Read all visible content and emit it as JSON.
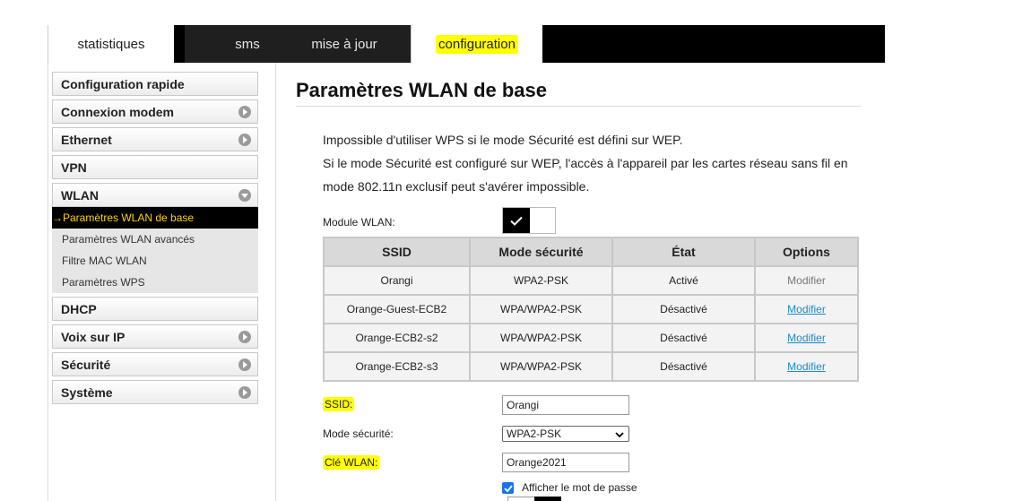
{
  "tabs": [
    {
      "label": "statistiques"
    },
    {
      "label": "sms"
    },
    {
      "label": "mise à jour"
    },
    {
      "label": "configuration"
    }
  ],
  "sidebar": {
    "items": [
      {
        "label": "Configuration rapide"
      },
      {
        "label": "Connexion modem"
      },
      {
        "label": "Ethernet"
      },
      {
        "label": "VPN"
      },
      {
        "label": "WLAN"
      },
      {
        "label": "DHCP"
      },
      {
        "label": "Voix sur IP"
      },
      {
        "label": "Sécurité"
      },
      {
        "label": "Système"
      }
    ],
    "wlan_sub": [
      {
        "label": "→Paramètres WLAN de base"
      },
      {
        "label": "Paramètres WLAN avancés"
      },
      {
        "label": "Filtre MAC WLAN"
      },
      {
        "label": "Paramètres WPS"
      }
    ]
  },
  "main": {
    "title": "Paramètres WLAN de base",
    "info_lines": [
      "Impossible d'utiliser WPS si le mode Sécurité est défini sur WEP.",
      "Si le mode Sécurité est configuré sur WEP, l'accès à l'appareil par les cartes réseau sans fil en",
      "mode 802.11n exclusif peut s'avérer impossible."
    ],
    "module_label": "Module WLAN:",
    "module_enabled": true,
    "table": {
      "headers": [
        "SSID",
        "Mode sécurité",
        "État",
        "Options"
      ],
      "rows": [
        [
          "Orangi",
          "WPA2-PSK",
          "Activé",
          "Modifier"
        ],
        [
          "Orange-Guest-ECB2",
          "WPA/WPA2-PSK",
          "Désactivé",
          "Modifier"
        ],
        [
          "Orange-ECB2-s2",
          "WPA/WPA2-PSK",
          "Désactivé",
          "Modifier"
        ],
        [
          "Orange-ECB2-s3",
          "WPA/WPA2-PSK",
          "Désactivé",
          "Modifier"
        ]
      ]
    },
    "form": {
      "ssid_label": "SSID:",
      "ssid_value": "Orangi",
      "security_label": "Mode sécurité:",
      "security_value": "WPA2-PSK",
      "key_label": "Clé WLAN:",
      "key_value": "Orange2021",
      "show_password_label": "Afficher le mot de passe",
      "show_password_checked": true
    }
  },
  "colors": {
    "highlight": "#ffff00",
    "active_sub_text": "#ffd400",
    "link": "#1a8bc9",
    "checkbox": "#1a73e8"
  }
}
